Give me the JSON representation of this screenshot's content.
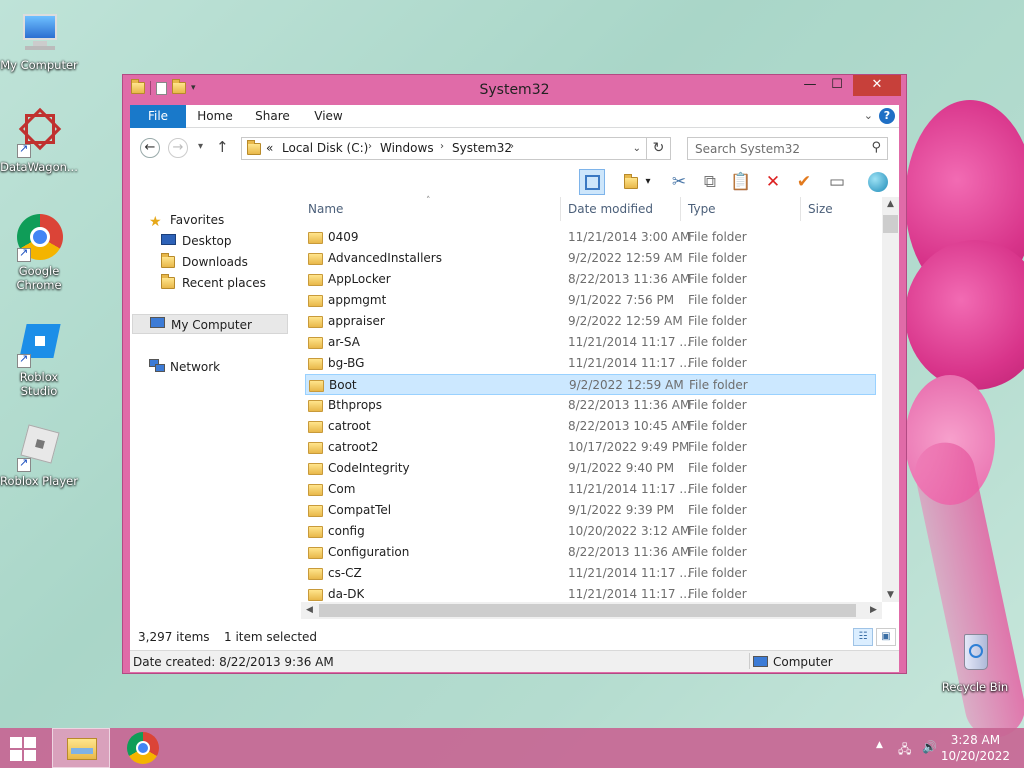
{
  "desktop": {
    "icons": [
      {
        "label": "My Computer"
      },
      {
        "label": "DataWagon..."
      },
      {
        "label": "Google Chrome"
      },
      {
        "label": "Roblox Studio"
      },
      {
        "label": "Roblox Player"
      },
      {
        "label": "Recycle Bin"
      }
    ]
  },
  "window": {
    "title": "System32",
    "controls": {
      "minimize": "—",
      "maximize": "☐",
      "close": "✕"
    }
  },
  "ribbon": {
    "tabs": [
      "File",
      "Home",
      "Share",
      "View"
    ],
    "help": "?"
  },
  "address": {
    "overflow": "«",
    "crumbs": [
      "Local Disk (C:)",
      "Windows",
      "System32"
    ],
    "search_placeholder": "Search System32"
  },
  "navpane": {
    "favorites": "Favorites",
    "desktop": "Desktop",
    "downloads": "Downloads",
    "recent": "Recent places",
    "my_computer": "My Computer",
    "network": "Network"
  },
  "columns": {
    "name": "Name",
    "date": "Date modified",
    "type": "Type",
    "size": "Size"
  },
  "files": [
    {
      "name": "0409",
      "date": "11/21/2014 3:00 AM",
      "type": "File folder"
    },
    {
      "name": "AdvancedInstallers",
      "date": "9/2/2022 12:59 AM",
      "type": "File folder"
    },
    {
      "name": "AppLocker",
      "date": "8/22/2013 11:36 AM",
      "type": "File folder"
    },
    {
      "name": "appmgmt",
      "date": "9/1/2022 7:56 PM",
      "type": "File folder"
    },
    {
      "name": "appraiser",
      "date": "9/2/2022 12:59 AM",
      "type": "File folder"
    },
    {
      "name": "ar-SA",
      "date": "11/21/2014 11:17 ...",
      "type": "File folder"
    },
    {
      "name": "bg-BG",
      "date": "11/21/2014 11:17 ...",
      "type": "File folder"
    },
    {
      "name": "Boot",
      "date": "9/2/2022 12:59 AM",
      "type": "File folder",
      "selected": true
    },
    {
      "name": "Bthprops",
      "date": "8/22/2013 11:36 AM",
      "type": "File folder"
    },
    {
      "name": "catroot",
      "date": "8/22/2013 10:45 AM",
      "type": "File folder"
    },
    {
      "name": "catroot2",
      "date": "10/17/2022 9:49 PM",
      "type": "File folder"
    },
    {
      "name": "CodeIntegrity",
      "date": "9/1/2022 9:40 PM",
      "type": "File folder"
    },
    {
      "name": "Com",
      "date": "11/21/2014 11:17 ...",
      "type": "File folder"
    },
    {
      "name": "CompatTel",
      "date": "9/1/2022 9:39 PM",
      "type": "File folder"
    },
    {
      "name": "config",
      "date": "10/20/2022 3:12 AM",
      "type": "File folder"
    },
    {
      "name": "Configuration",
      "date": "8/22/2013 11:36 AM",
      "type": "File folder"
    },
    {
      "name": "cs-CZ",
      "date": "11/21/2014 11:17 ...",
      "type": "File folder"
    },
    {
      "name": "da-DK",
      "date": "11/21/2014 11:17 ...",
      "type": "File folder"
    }
  ],
  "status": {
    "items": "3,297 items",
    "selected": "1 item selected",
    "date_created": "Date created: 8/22/2013 9:36 AM",
    "location": "Computer"
  },
  "taskbar": {
    "time": "3:28 AM",
    "date": "10/20/2022"
  },
  "colors": {
    "file_tab": "#1979ca",
    "selection": "#cce8ff",
    "window_frame": "#e06ba8",
    "close": "#c7403a"
  }
}
